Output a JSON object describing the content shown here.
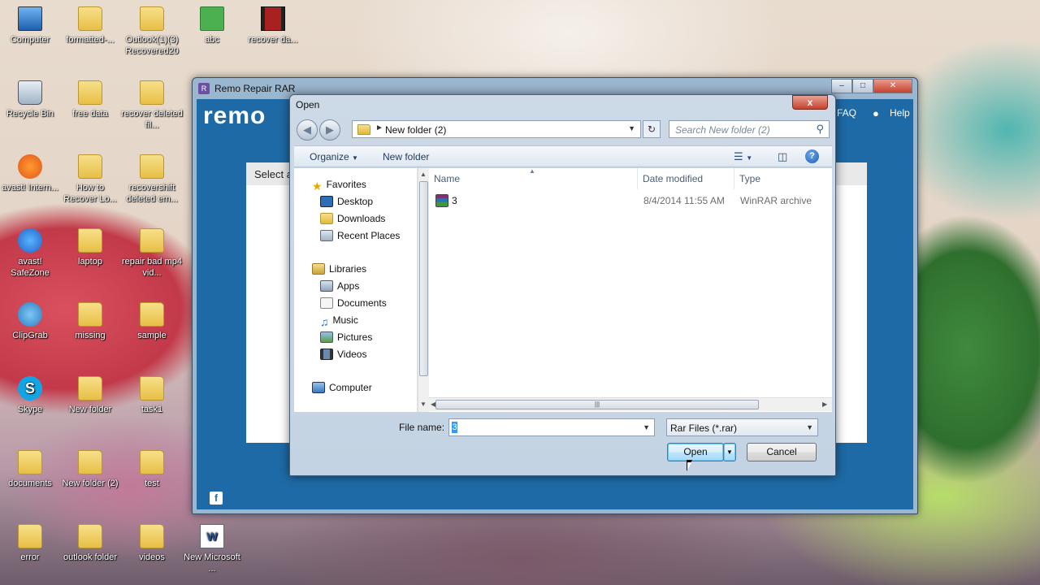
{
  "desktop": {
    "icons": [
      {
        "label": "Computer"
      },
      {
        "label": "formatted-..."
      },
      {
        "label": "Outlook(1)(3) Recovered20"
      },
      {
        "label": "abc"
      },
      {
        "label": "recover da..."
      },
      {
        "label": "Recycle Bin"
      },
      {
        "label": "free data"
      },
      {
        "label": "recover deleted fil..."
      },
      {
        "label": "avast! Intern..."
      },
      {
        "label": "How to Recover Lo..."
      },
      {
        "label": "recovershift deleted em..."
      },
      {
        "label": "avast! SafeZone"
      },
      {
        "label": "laptop"
      },
      {
        "label": "repair bad mp4 vid..."
      },
      {
        "label": "ClipGrab"
      },
      {
        "label": "missing"
      },
      {
        "label": "sample"
      },
      {
        "label": "Skype"
      },
      {
        "label": "New folder"
      },
      {
        "label": "task1"
      },
      {
        "label": "documents"
      },
      {
        "label": "New folder (2)"
      },
      {
        "label": "test"
      },
      {
        "label": "error"
      },
      {
        "label": "outlook folder"
      },
      {
        "label": "videos"
      },
      {
        "label": "New Microsoft ..."
      }
    ]
  },
  "remo_window": {
    "title": "Remo Repair RAR",
    "logo": "remo",
    "faq": "FAQ",
    "help": "Help",
    "panel_heading": "Select a"
  },
  "dialog": {
    "title": "Open",
    "close_glyph": "x",
    "address": {
      "path": "New folder (2)"
    },
    "search_placeholder": "Search New folder (2)",
    "toolbar": {
      "organize": "Organize",
      "new_folder": "New folder"
    },
    "nav": {
      "favorites": "Favorites",
      "desktop": "Desktop",
      "downloads": "Downloads",
      "recent_places": "Recent Places",
      "libraries": "Libraries",
      "apps": "Apps",
      "documents": "Documents",
      "music": "Music",
      "pictures": "Pictures",
      "videos": "Videos",
      "computer": "Computer"
    },
    "columns": {
      "name": "Name",
      "date_modified": "Date modified",
      "type": "Type"
    },
    "files": [
      {
        "name": "3",
        "date_modified": "8/4/2014 11:55 AM",
        "type": "WinRAR archive"
      }
    ],
    "file_name_label": "File name:",
    "file_name_value": "3",
    "file_type": "Rar Files (*.rar)",
    "open_button": "Open",
    "cancel_button": "Cancel"
  },
  "colors": {
    "remo_blue": "#1e6aa6",
    "dialog_frame": "#c4d3e3"
  }
}
